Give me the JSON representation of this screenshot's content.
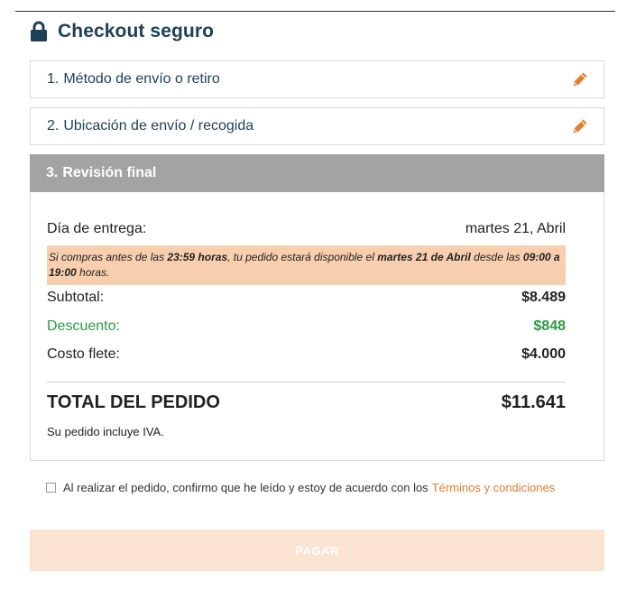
{
  "header": {
    "title": "Checkout seguro"
  },
  "steps": [
    {
      "number": "1.",
      "label": "Método de envío o retiro",
      "action_icon": "pencil-icon"
    },
    {
      "number": "2.",
      "label": "Ubicación de envío / recogida",
      "action_icon": "pencil-icon"
    },
    {
      "number": "3.",
      "label": "Revisión final"
    }
  ],
  "review": {
    "delivery_label": "Día de entrega:",
    "delivery_value": "martes 21, Abril",
    "notice": {
      "t1": "Si compras antes de las ",
      "time_cutoff": "23:59 horas",
      "t2": ", tu pedido estará disponible el ",
      "date": "martes 21 de Abril",
      "t3": " desde las ",
      "time_range": "09:00 a 19:00",
      "t4": " horas."
    },
    "subtotal_label": "Subtotal:",
    "subtotal_value": "$8.489",
    "discount_label": "Descuento:",
    "discount_value": "$848",
    "shipping_label": "Costo flete:",
    "shipping_value": "$4.000",
    "total_label": "TOTAL DEL PEDIDO",
    "total_value": "$11.641",
    "iva_note": "Su pedido incluye IVA."
  },
  "terms": {
    "text": "Al realizar el pedido, confirmo que he leído y estoy de acuerdo con los",
    "link": "Términos y condiciones",
    "checked": false
  },
  "pay_button": {
    "label": "PAGAR"
  },
  "colors": {
    "title": "#1d3f57",
    "accent_orange": "#e07e2e",
    "discount_green": "#2a9a48",
    "notice_bg": "#f8cfae",
    "step_active_bg": "#a3a3a3",
    "pay_button_bg": "#fbe3d1"
  }
}
